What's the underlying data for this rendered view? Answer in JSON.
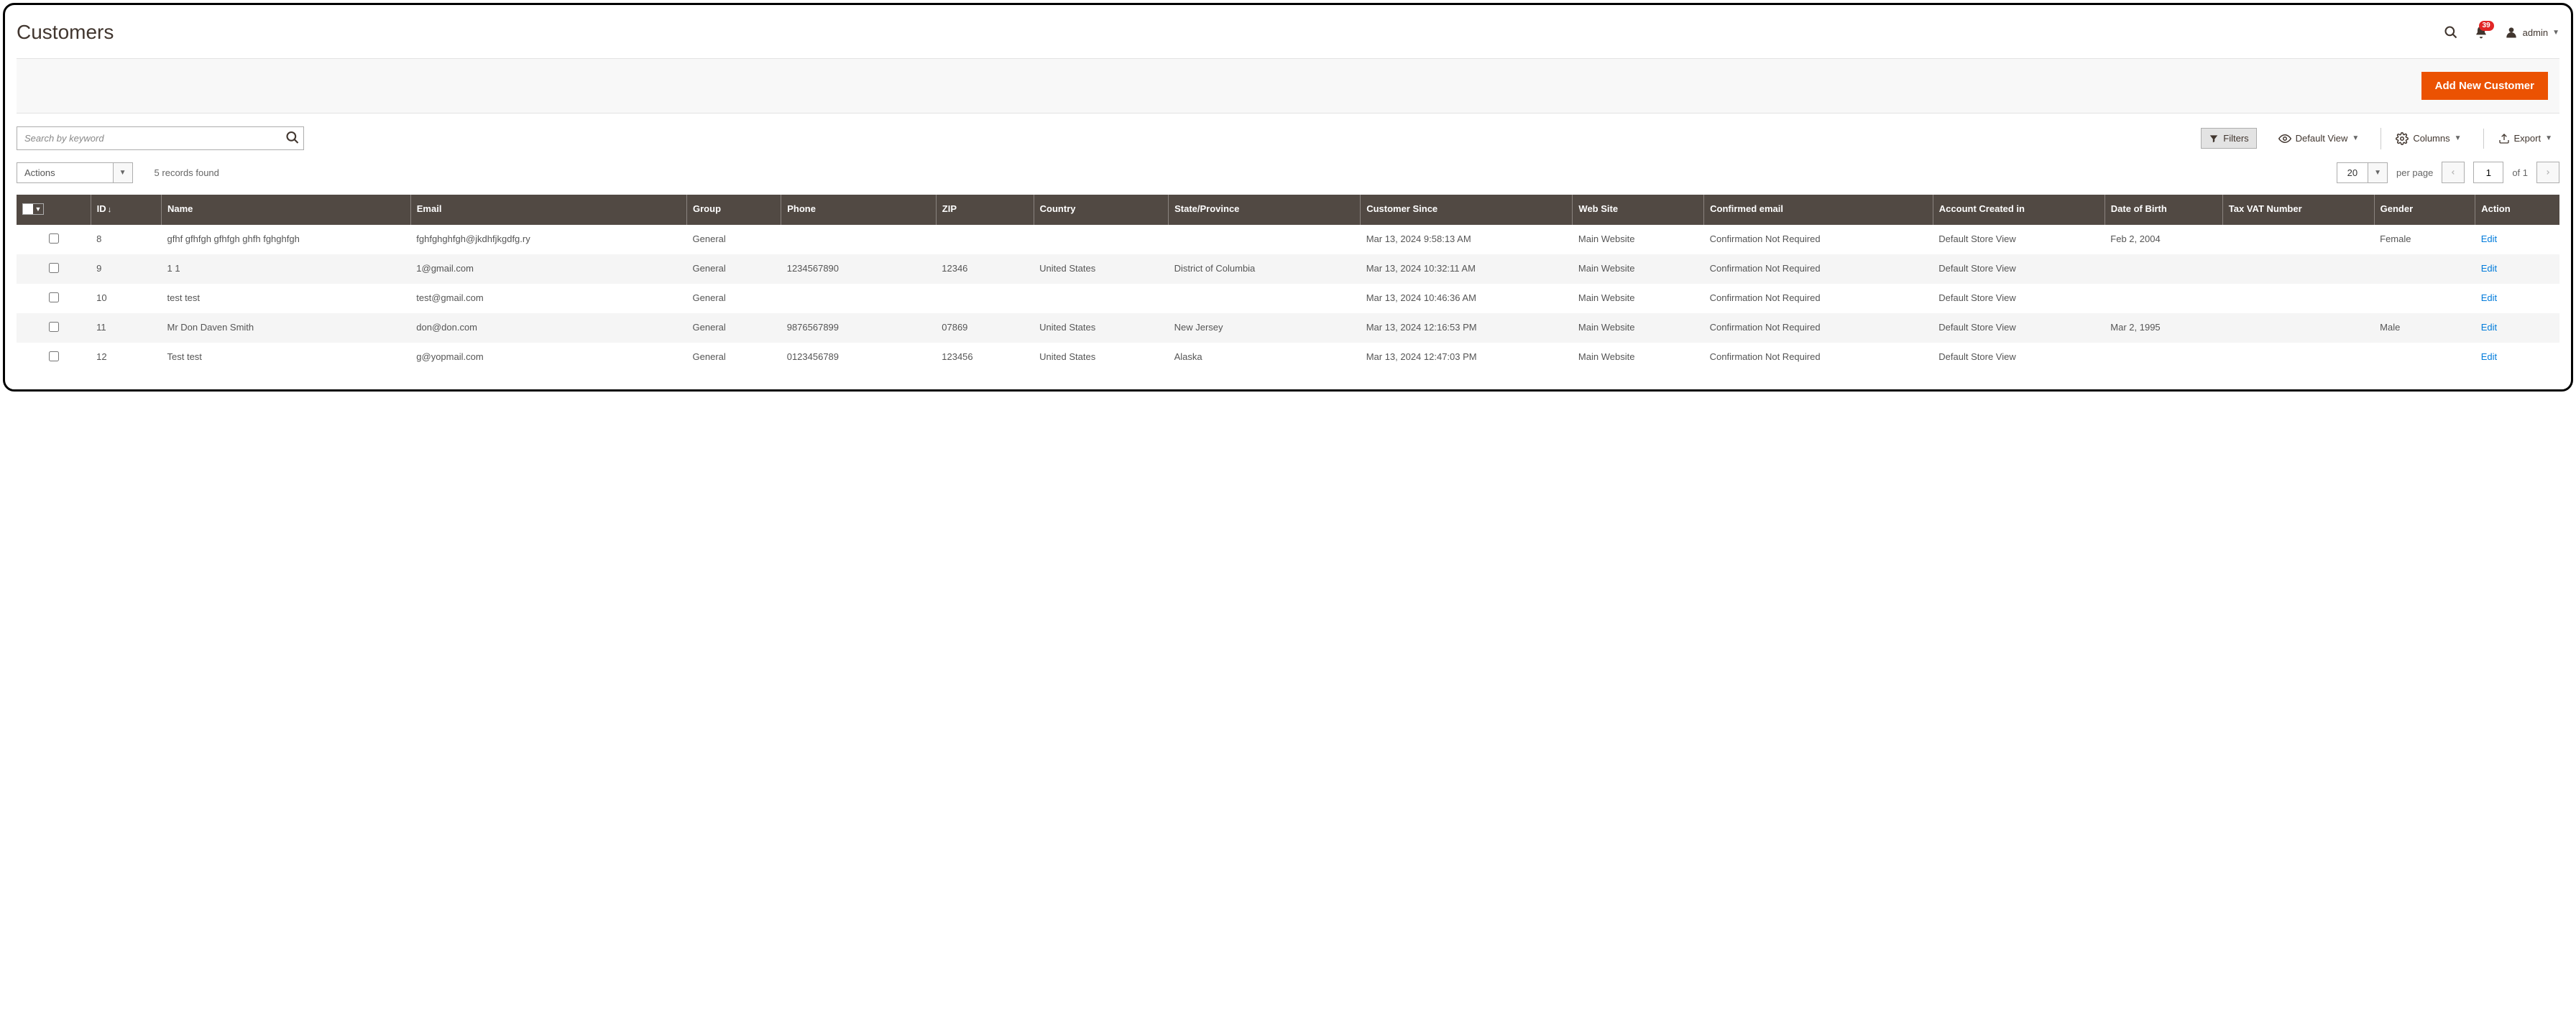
{
  "header": {
    "title": "Customers",
    "notification_count": "39",
    "user_label": "admin"
  },
  "buttons": {
    "add_new": "Add New Customer"
  },
  "search": {
    "placeholder": "Search by keyword"
  },
  "view_controls": {
    "filters": "Filters",
    "default_view": "Default View",
    "columns": "Columns",
    "export": "Export"
  },
  "sub_toolbar": {
    "actions_label": "Actions",
    "records_found": "5 records found",
    "per_page_value": "20",
    "per_page_label": "per page",
    "page_value": "1",
    "page_of": "of 1"
  },
  "table": {
    "headers": {
      "id": "ID",
      "name": "Name",
      "email": "Email",
      "group": "Group",
      "phone": "Phone",
      "zip": "ZIP",
      "country": "Country",
      "state": "State/Province",
      "customer_since": "Customer Since",
      "web_site": "Web Site",
      "confirmed_email": "Confirmed email",
      "account_created_in": "Account Created in",
      "dob": "Date of Birth",
      "tax_vat": "Tax VAT Number",
      "gender": "Gender",
      "action": "Action"
    },
    "rows": [
      {
        "id": "8",
        "name": "gfhf gfhfgh gfhfgh ghfh fghghfgh",
        "email": "fghfghghfgh@jkdhfjkgdfg.ry",
        "group": "General",
        "phone": "",
        "zip": "",
        "country": "",
        "state": "",
        "customer_since": "Mar 13, 2024 9:58:13 AM",
        "web_site": "Main Website",
        "confirmed_email": "Confirmation Not Required",
        "account_created_in": "Default Store View",
        "dob": "Feb 2, 2004",
        "tax_vat": "",
        "gender": "Female",
        "action": "Edit"
      },
      {
        "id": "9",
        "name": "1 1",
        "email": "1@gmail.com",
        "group": "General",
        "phone": "1234567890",
        "zip": "12346",
        "country": "United States",
        "state": "District of Columbia",
        "customer_since": "Mar 13, 2024 10:32:11 AM",
        "web_site": "Main Website",
        "confirmed_email": "Confirmation Not Required",
        "account_created_in": "Default Store View",
        "dob": "",
        "tax_vat": "",
        "gender": "",
        "action": "Edit"
      },
      {
        "id": "10",
        "name": "test test",
        "email": "test@gmail.com",
        "group": "General",
        "phone": "",
        "zip": "",
        "country": "",
        "state": "",
        "customer_since": "Mar 13, 2024 10:46:36 AM",
        "web_site": "Main Website",
        "confirmed_email": "Confirmation Not Required",
        "account_created_in": "Default Store View",
        "dob": "",
        "tax_vat": "",
        "gender": "",
        "action": "Edit"
      },
      {
        "id": "11",
        "name": "Mr Don Daven Smith",
        "email": "don@don.com",
        "group": "General",
        "phone": "9876567899",
        "zip": "07869",
        "country": "United States",
        "state": "New Jersey",
        "customer_since": "Mar 13, 2024 12:16:53 PM",
        "web_site": "Main Website",
        "confirmed_email": "Confirmation Not Required",
        "account_created_in": "Default Store View",
        "dob": "Mar 2, 1995",
        "tax_vat": "",
        "gender": "Male",
        "action": "Edit"
      },
      {
        "id": "12",
        "name": "Test test",
        "email": "g@yopmail.com",
        "group": "General",
        "phone": "0123456789",
        "zip": "123456",
        "country": "United States",
        "state": "Alaska",
        "customer_since": "Mar 13, 2024 12:47:03 PM",
        "web_site": "Main Website",
        "confirmed_email": "Confirmation Not Required",
        "account_created_in": "Default Store View",
        "dob": "",
        "tax_vat": "",
        "gender": "",
        "action": "Edit"
      }
    ]
  }
}
